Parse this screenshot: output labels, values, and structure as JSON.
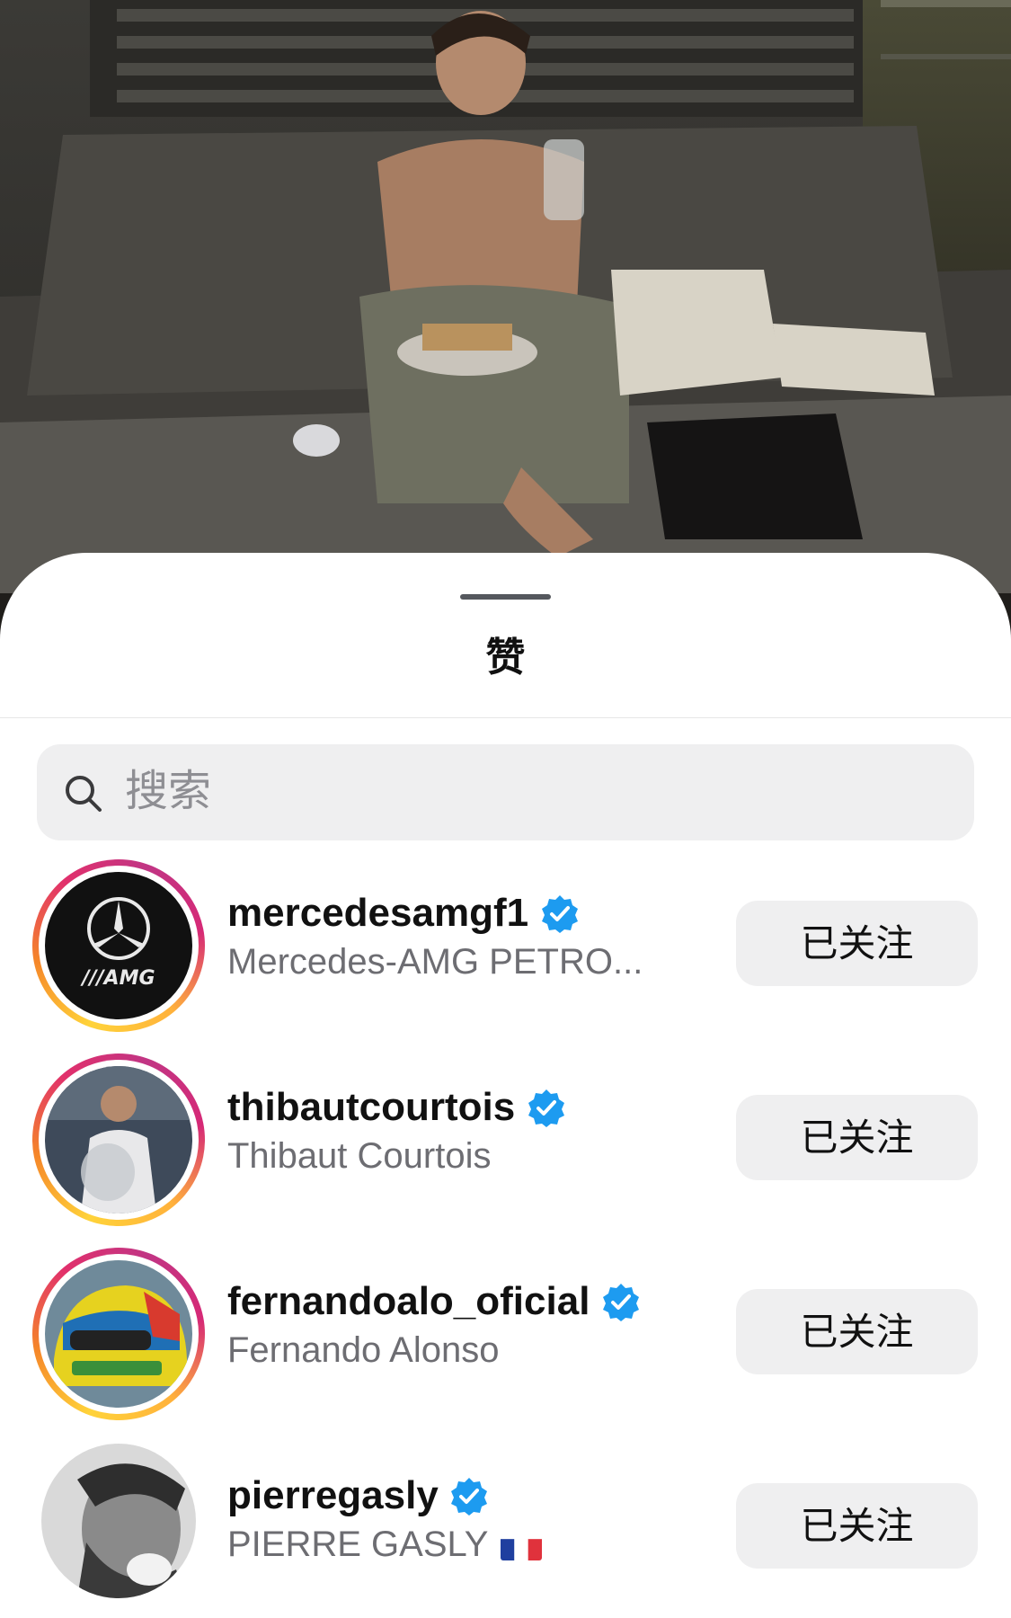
{
  "sheet": {
    "title": "赞"
  },
  "search": {
    "placeholder": "搜索",
    "icon": "search-icon"
  },
  "accent": {
    "ring_colors": [
      "#ffd33a",
      "#f58529",
      "#e1306c",
      "#c13584"
    ],
    "verified": "#1d9bf0",
    "button_bg": "#efeff0"
  },
  "likes": [
    {
      "username": "mercedesamgf1",
      "full_name": "Mercedes-AMG PETRO...",
      "verified": true,
      "has_story_ring": true,
      "button": "已关注"
    },
    {
      "username": "thibautcourtois",
      "full_name": "Thibaut Courtois",
      "verified": true,
      "has_story_ring": true,
      "button": "已关注"
    },
    {
      "username": "fernandoalo_oficial",
      "full_name": "Fernando Alonso",
      "verified": true,
      "has_story_ring": true,
      "button": "已关注"
    },
    {
      "username": "pierregasly",
      "full_name": "PIERRE GASLY",
      "verified": true,
      "has_story_ring": false,
      "flag": "france-flag-icon",
      "button": "已关注"
    }
  ]
}
